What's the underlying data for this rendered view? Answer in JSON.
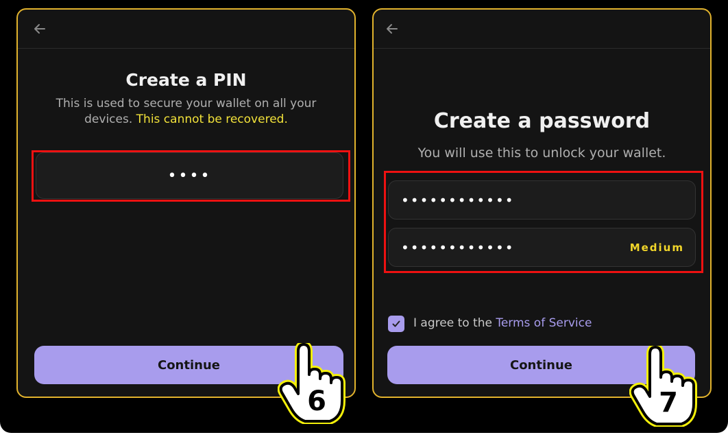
{
  "colors": {
    "accent": "#a89ced",
    "panel_border": "#e2b32d",
    "warning": "#f2e23a",
    "highlight": "#ee1111"
  },
  "left": {
    "back_icon": "arrow-left-icon",
    "title": "Create a PIN",
    "subtitle_plain": "This is used to secure your wallet on all your devices.",
    "subtitle_warning": "This cannot be recovered.",
    "pin_value": "••••",
    "continue_label": "Continue",
    "step_number": "6"
  },
  "right": {
    "back_icon": "arrow-left-icon",
    "title": "Create a password",
    "subtitle": "You will use this to unlock your wallet.",
    "password_value": "••••••••••••",
    "confirm_value": "••••••••••••",
    "strength_label": "Medium",
    "agree_text": "I agree to the",
    "terms_link": "Terms of Service",
    "terms_checked": true,
    "continue_label": "Continue",
    "step_number": "7"
  }
}
